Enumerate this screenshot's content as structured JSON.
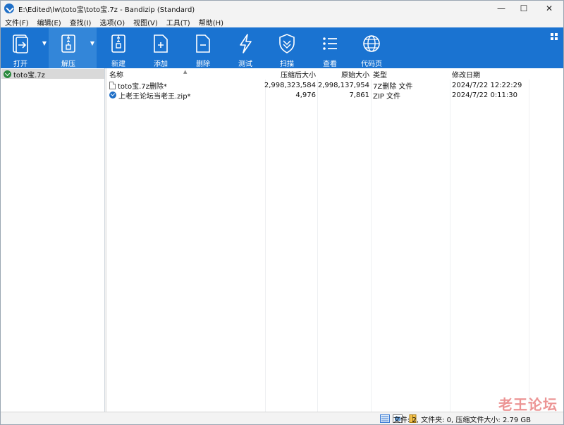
{
  "window": {
    "title": "E:\\Edited\\lw\\toto宝\\toto宝.7z - Bandizip (Standard)",
    "controls": {
      "minimize": "—",
      "maximize": "☐",
      "close": "✕"
    }
  },
  "menu": {
    "items": [
      "文件(F)",
      "编辑(E)",
      "查找(I)",
      "选项(O)",
      "视图(V)",
      "工具(T)",
      "帮助(H)"
    ]
  },
  "toolbar": {
    "background": "#1a73d1",
    "buttons": [
      {
        "label": "打开",
        "icon": "open-archive-icon"
      },
      {
        "label": "解压",
        "icon": "extract-icon"
      },
      {
        "label": "新建",
        "icon": "new-archive-icon"
      },
      {
        "label": "添加",
        "icon": "add-file-icon"
      },
      {
        "label": "删除",
        "icon": "delete-file-icon"
      },
      {
        "label": "测试",
        "icon": "test-lightning-icon"
      },
      {
        "label": "扫描",
        "icon": "scan-shield-icon"
      },
      {
        "label": "查看",
        "icon": "view-list-icon"
      },
      {
        "label": "代码页",
        "icon": "codepage-globe-icon"
      }
    ]
  },
  "tree": {
    "items": [
      {
        "label": "toto宝.7z",
        "selected": true
      }
    ]
  },
  "filelist": {
    "columns": [
      "名称",
      "压缩后大小",
      "原始大小",
      "类型",
      "修改日期"
    ],
    "rows": [
      {
        "name": "toto宝.7z删除*",
        "packed": "2,998,323,584",
        "size": "2,998,137,954",
        "type": "7Z删除 文件",
        "modified": "2024/7/22 12:22:29",
        "icon": "document-icon"
      },
      {
        "name": "上老王论坛当老王.zip*",
        "packed": "4,976",
        "size": "7,861",
        "type": "ZIP 文件",
        "modified": "2024/7/22 0:11:30",
        "icon": "zip-archive-icon"
      }
    ]
  },
  "statusbar": {
    "text": "文件: 2, 文件夹: 0, 压缩文件大小: 2.79 GB"
  },
  "watermark": "老王论坛"
}
